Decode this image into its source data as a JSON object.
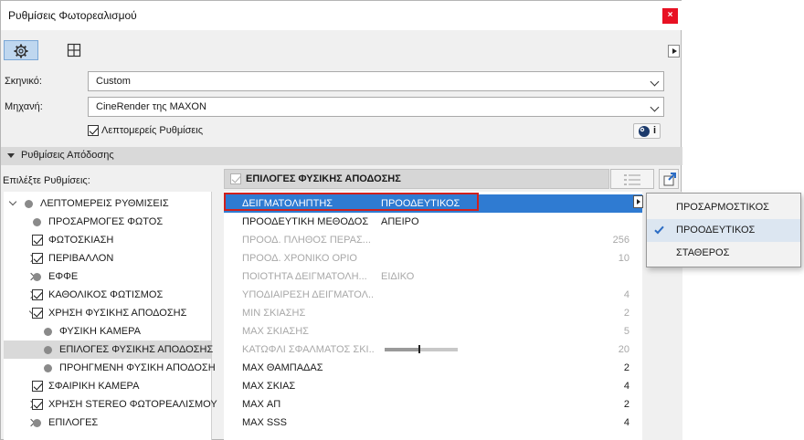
{
  "window": {
    "title": "Ρυθμίσεις Φωτορεαλισμού",
    "close_icon": "×"
  },
  "toolbar": {
    "tabs": [
      {
        "icon": "gear-icon"
      },
      {
        "icon": "grid-layout-icon"
      }
    ]
  },
  "scene": {
    "label": "Σκηνικό:",
    "value": "Custom"
  },
  "engine": {
    "label": "Μηχανή:",
    "value": "CineRender της MAXON"
  },
  "detailed_settings": {
    "label": "Λεπτομερείς Ρυθμίσεις",
    "checked": true
  },
  "render_section": {
    "title": "Ρυθμίσεις Απόδοσης"
  },
  "choose_settings_label": "Επιλέξτε Ρυθμίσεις:",
  "tree": {
    "items": [
      {
        "label": "ΛΕΠΤΟΜΕΡΕΙΣ ΡΥΘΜΙΣΕΙΣ",
        "expand": "down",
        "marker": "dot",
        "level": 0
      },
      {
        "label": "ΠΡΟΣΑΡΜΟΓΕΣ ΦΩΤΟΣ",
        "expand": "none",
        "marker": "dot",
        "level": 1
      },
      {
        "label": "ΦΩΤΟΣΚΙΑΣΗ",
        "expand": "none",
        "marker": "check",
        "level": 1
      },
      {
        "label": "ΠΕΡΙΒΑΛΛΟΝ",
        "expand": "right",
        "marker": "check",
        "level": 1
      },
      {
        "label": "ΕΦΦΕ",
        "expand": "right",
        "marker": "dot",
        "level": 1
      },
      {
        "label": "ΚΑΘΟΛΙΚΟΣ ΦΩΤΙΣΜΟΣ",
        "expand": "right",
        "marker": "check",
        "level": 1
      },
      {
        "label": "ΧΡΗΣΗ ΦΥΣΙΚΗΣ ΑΠΟΔΟΣΗΣ",
        "expand": "down",
        "marker": "check",
        "level": 1
      },
      {
        "label": "ΦΥΣΙΚΗ ΚΑΜΕΡΑ",
        "expand": "none",
        "marker": "dot",
        "level": 2
      },
      {
        "label": "ΕΠΙΛΟΓΕΣ ΦΥΣΙΚΗΣ ΑΠΟΔΟΣΗΣ",
        "expand": "none",
        "marker": "dot",
        "level": 2,
        "selected": true
      },
      {
        "label": "ΠΡΟΗΓΜΕΝΗ ΦΥΣΙΚΗ ΑΠΟΔΟΣΗ",
        "expand": "none",
        "marker": "dot",
        "level": 2
      },
      {
        "label": "ΣΦΑΙΡΙΚΗ ΚΑΜΕΡΑ",
        "expand": "none",
        "marker": "check",
        "level": 1
      },
      {
        "label": "ΧΡΗΣΗ STEREO ΦΩΤΟΡΕΑΛΙΣΜΟΥ",
        "expand": "right",
        "marker": "check",
        "level": 1
      },
      {
        "label": "ΕΠΙΛΟΓΕΣ",
        "expand": "right",
        "marker": "dot",
        "level": 1
      }
    ]
  },
  "props_header": {
    "title": "ΕΠΙΛΟΓΕΣ ΦΥΣΙΚΗΣ ΑΠΟΔΟΣΗΣ",
    "checked": true
  },
  "properties": [
    {
      "name": "ΔΕΙΓΜΑΤΟΛΗΠΤΗΣ",
      "value": "ΠΡΟΟΔΕΥΤΙΚΟΣ",
      "num": "",
      "state": "selected"
    },
    {
      "name": "ΠΡΟΟΔΕΥΤΙΚΗ ΜΕΘΟΔΟΣ",
      "value": "ΑΠΕΙΡΟ",
      "num": "",
      "state": "normal"
    },
    {
      "name": "ΠΡΟΟΔ. ΠΛΗΘΟΣ ΠΕΡΑΣ...",
      "value": "",
      "num": "256",
      "state": "dim"
    },
    {
      "name": "ΠΡΟΟΔ. ΧΡΟΝΙΚΟ ΟΡΙΟ",
      "value": "",
      "num": "10",
      "state": "dim"
    },
    {
      "name": "ΠΟΙΟΤΗΤΑ ΔΕΙΓΜΑΤΟΛΗ...",
      "value": "ΕΙΔΙΚΟ",
      "num": "",
      "state": "dim"
    },
    {
      "name": "ΥΠΟΔΙΑΙΡΕΣΗ ΔΕΙΓΜΑΤΟΛ...",
      "value": "",
      "num": "4",
      "state": "dim"
    },
    {
      "name": "MIN ΣΚΙΑΣΗΣ",
      "value": "",
      "num": "2",
      "state": "dim"
    },
    {
      "name": "MAX ΣΚΙΑΣΗΣ",
      "value": "",
      "num": "5",
      "state": "dim"
    },
    {
      "name": "ΚΑΤΩΦΛΙ ΣΦΑΛΜΑΤΟΣ ΣΚΙ...",
      "value": "",
      "num": "20",
      "state": "dim",
      "slider": 0.2
    },
    {
      "name": "MAX ΘΑΜΠΑΔΑΣ",
      "value": "",
      "num": "2",
      "state": "normal"
    },
    {
      "name": "MAX ΣΚΙΑΣ",
      "value": "",
      "num": "4",
      "state": "normal"
    },
    {
      "name": "MAX ΑΠ",
      "value": "",
      "num": "2",
      "state": "normal"
    },
    {
      "name": "MAX SSS",
      "value": "",
      "num": "4",
      "state": "normal"
    }
  ],
  "popup": {
    "options": [
      {
        "label": "ΠΡΟΣΑΡΜΟΣΤΙΚΟΣ",
        "checked": false
      },
      {
        "label": "ΠΡΟΟΔΕΥΤΙΚΟΣ",
        "checked": true
      },
      {
        "label": "ΣΤΑΘΕΡΟΣ",
        "checked": false
      }
    ]
  },
  "colors": {
    "selection": "#2f7bd2",
    "highlight_border": "#d0201d",
    "close": "#e81123"
  }
}
